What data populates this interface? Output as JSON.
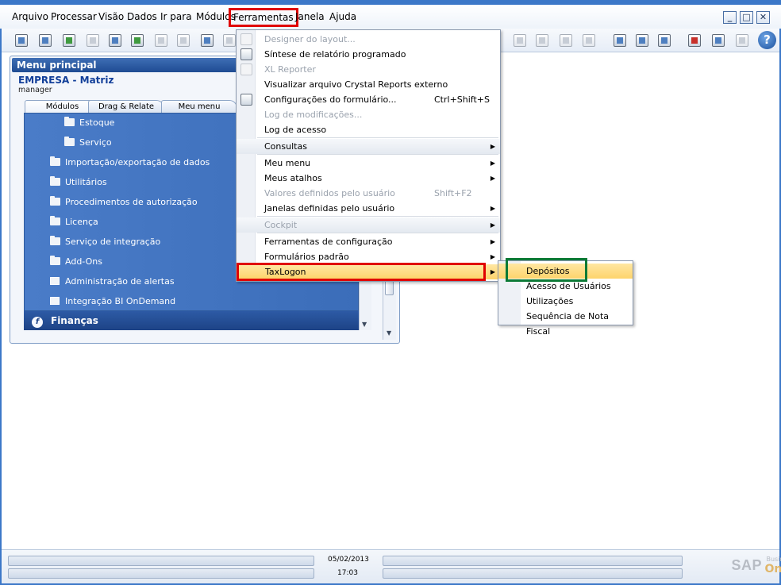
{
  "menubar": {
    "items": [
      "Arquivo",
      "Processar",
      "Visão",
      "Dados",
      "Ir para",
      "Módulos",
      "Ferramentas",
      "Janela",
      "Ajuda"
    ],
    "active": "Ferramentas"
  },
  "window_controls": {
    "minimize": "_",
    "restore": "□",
    "close": "✕"
  },
  "toolbar": {
    "icons": [
      "print-preview-icon",
      "print-icon",
      "export-icon",
      "fax-icon",
      "printer-icon",
      "excel-icon",
      "word-icon",
      "pdf-icon",
      "navigate-icon",
      "field-icon",
      "warehouse-icon",
      "scales-icon",
      "book-icon",
      "calc-icon",
      "edit-icon",
      "settings-icon",
      "database-icon",
      "mail-icon",
      "calendar-icon",
      "tree-icon",
      "help-icon"
    ],
    "help_label": "?"
  },
  "main_menu": {
    "title": "Menu principal",
    "company": "EMPRESA - Matriz",
    "user": "manager",
    "tabs": [
      "Módulos",
      "Drag & Relate",
      "Meu menu"
    ],
    "tree": [
      {
        "label": "Estoque",
        "icon": "folder-icon",
        "indent": 2
      },
      {
        "label": "Serviço",
        "icon": "folder-icon",
        "indent": 2
      },
      {
        "label": "Importação/exportação de dados",
        "icon": "folder-icon",
        "indent": 1
      },
      {
        "label": "Utilitários",
        "icon": "folder-icon",
        "indent": 1
      },
      {
        "label": "Procedimentos de autorização",
        "icon": "folder-icon",
        "indent": 1
      },
      {
        "label": "Licença",
        "icon": "folder-icon",
        "indent": 1
      },
      {
        "label": "Serviço de integração",
        "icon": "folder-icon",
        "indent": 1
      },
      {
        "label": "Add-Ons",
        "icon": "folder-icon",
        "indent": 1
      },
      {
        "label": "Administração de alertas",
        "icon": "window-icon",
        "indent": 1
      },
      {
        "label": "Integração BI OnDemand",
        "icon": "window-icon",
        "indent": 1
      }
    ],
    "financas": "Finanças"
  },
  "dropdown": {
    "items": [
      {
        "label": "Designer do layout...",
        "disabled": true,
        "icon": "pencil-icon"
      },
      {
        "label": "Síntese de relatório programado",
        "disabled": false,
        "icon": "report-schedule-icon"
      },
      {
        "label": "XL Reporter",
        "disabled": true,
        "icon": "xl-reporter-icon"
      },
      {
        "label": "Visualizar arquivo Crystal Reports externo",
        "disabled": false
      },
      {
        "label": "Configurações do formulário...",
        "shortcut": "Ctrl+Shift+S",
        "disabled": false,
        "icon": "form-settings-icon"
      },
      {
        "label": "Log de modificações...",
        "disabled": true
      },
      {
        "label": "Log de acesso",
        "disabled": false
      },
      {
        "label": "Consultas",
        "submenu": true,
        "disabled": false,
        "shade": true
      },
      {
        "label": "Meu menu",
        "submenu": true,
        "disabled": false
      },
      {
        "label": "Meus atalhos",
        "submenu": true,
        "disabled": false
      },
      {
        "label": "Valores definidos pelo usuário",
        "shortcut": "Shift+F2",
        "disabled": true
      },
      {
        "label": "Janelas definidas pelo usuário",
        "submenu": true,
        "disabled": false
      },
      {
        "label": "Cockpit",
        "submenu": true,
        "disabled": true,
        "shade": true
      },
      {
        "label": "Ferramentas de configuração",
        "submenu": true,
        "disabled": false
      },
      {
        "label": "Formulários padrão",
        "submenu": true,
        "disabled": false
      },
      {
        "label": "TaxLogon",
        "submenu": true,
        "disabled": false,
        "highlighted": true
      }
    ]
  },
  "submenu": {
    "items": [
      "Depósitos",
      "Acesso de Usuários",
      "Utilizações",
      "Sequência de Nota Fiscal"
    ],
    "highlighted": "Depósitos"
  },
  "statusbar": {
    "date": "05/02/2013",
    "time": "17:03",
    "logo_main": "SAP",
    "logo_business": "Business",
    "logo_one": "One"
  },
  "colors": {
    "frame": "#3c78c8",
    "tree_bg": "#4a7cc8",
    "highlight": "#fdd46c",
    "red_box": "#e00000",
    "green_box": "#0c7a36"
  }
}
